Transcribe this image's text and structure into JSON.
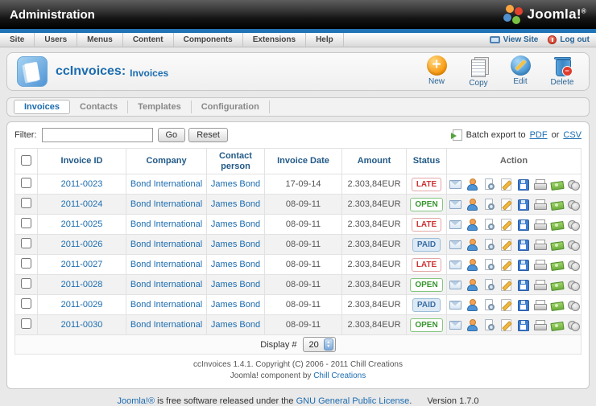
{
  "colors": {
    "accent_blue": "#1b6cb0",
    "menu_strip_blue": "#2273b5",
    "status_late": "#cc3333",
    "status_open": "#36952e",
    "status_paid": "#3a6ea5",
    "paid_badge_bg": "#ddeaf6"
  },
  "topbar": {
    "title": "Administration",
    "logo_text": "Joomla!",
    "logo_mark": "®"
  },
  "menubar": {
    "items": [
      "Site",
      "Users",
      "Menus",
      "Content",
      "Components",
      "Extensions",
      "Help"
    ],
    "view_site": "View Site",
    "log_out": "Log out"
  },
  "header": {
    "component": "ccInvoices:",
    "view": "Invoices",
    "toolbar": [
      {
        "icon": "new-icon",
        "label": "New"
      },
      {
        "icon": "copy-icon",
        "label": "Copy"
      },
      {
        "icon": "edit-icon",
        "label": "Edit"
      },
      {
        "icon": "delete-icon",
        "label": "Delete"
      }
    ]
  },
  "tabs": [
    {
      "label": "Invoices",
      "active": true
    },
    {
      "label": "Contacts",
      "active": false
    },
    {
      "label": "Templates",
      "active": false
    },
    {
      "label": "Configuration",
      "active": false
    }
  ],
  "filter": {
    "label": "Filter:",
    "value": "",
    "go": "Go",
    "reset": "Reset"
  },
  "export": {
    "prefix": "Batch export to",
    "pdf": "PDF",
    "or": "or",
    "csv": "CSV"
  },
  "table": {
    "headers": [
      {
        "label": "Invoice ID",
        "sortable": true
      },
      {
        "label": "Company",
        "sortable": true
      },
      {
        "label": "Contact person",
        "sortable": true
      },
      {
        "label": "Invoice Date",
        "sortable": true
      },
      {
        "label": "Amount",
        "sortable": true
      },
      {
        "label": "Status",
        "sortable": true
      },
      {
        "label": "Action",
        "sortable": false
      }
    ],
    "action_icons": [
      "send-email-icon",
      "contact-icon",
      "preview-icon",
      "edit-doc-icon",
      "download-icon",
      "print-icon",
      "payment-icon",
      "credit-icon"
    ],
    "rows": [
      {
        "invoice_id": "2011-0023",
        "company": "Bond International",
        "contact": "James Bond",
        "date": "17-09-14",
        "amount": "2.303,84EUR",
        "status": "LATE"
      },
      {
        "invoice_id": "2011-0024",
        "company": "Bond International",
        "contact": "James Bond",
        "date": "08-09-11",
        "amount": "2.303,84EUR",
        "status": "OPEN"
      },
      {
        "invoice_id": "2011-0025",
        "company": "Bond International",
        "contact": "James Bond",
        "date": "08-09-11",
        "amount": "2.303,84EUR",
        "status": "LATE"
      },
      {
        "invoice_id": "2011-0026",
        "company": "Bond International",
        "contact": "James Bond",
        "date": "08-09-11",
        "amount": "2.303,84EUR",
        "status": "PAID"
      },
      {
        "invoice_id": "2011-0027",
        "company": "Bond International",
        "contact": "James Bond",
        "date": "08-09-11",
        "amount": "2.303,84EUR",
        "status": "LATE"
      },
      {
        "invoice_id": "2011-0028",
        "company": "Bond International",
        "contact": "James Bond",
        "date": "08-09-11",
        "amount": "2.303,84EUR",
        "status": "OPEN"
      },
      {
        "invoice_id": "2011-0029",
        "company": "Bond International",
        "contact": "James Bond",
        "date": "08-09-11",
        "amount": "2.303,84EUR",
        "status": "PAID"
      },
      {
        "invoice_id": "2011-0030",
        "company": "Bond International",
        "contact": "James Bond",
        "date": "08-09-11",
        "amount": "2.303,84EUR",
        "status": "OPEN"
      }
    ]
  },
  "pagination": {
    "label": "Display #",
    "value": "20"
  },
  "panel_footer": {
    "line1": "ccInvoices 1.4.1. Copyright (C) 2006 - 2011 Chill Creations",
    "line2_prefix": "Joomla! component by",
    "line2_link": "Chill Creations"
  },
  "page_footer": {
    "joomla": "Joomla!®",
    "text": "is free software released under the",
    "gnu": "GNU General Public License",
    "period": ".",
    "version": "Version 1.7.0"
  }
}
